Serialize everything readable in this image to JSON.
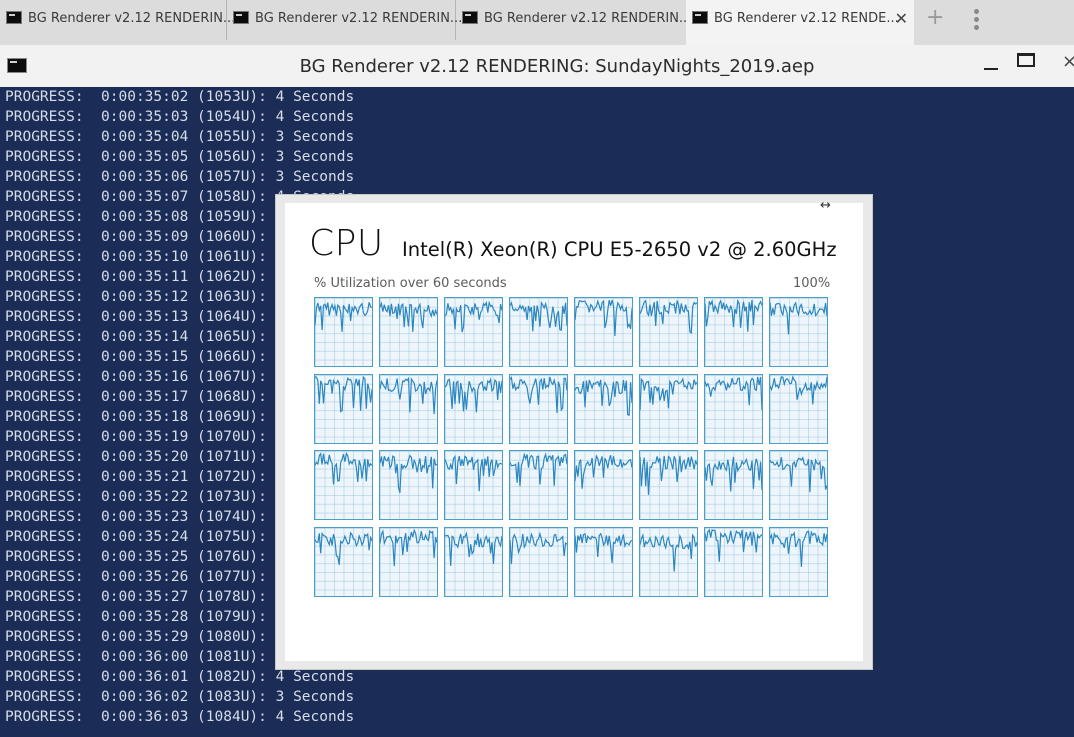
{
  "tabs": [
    {
      "title": "BG Renderer v2.12 RENDERIN...",
      "active": false
    },
    {
      "title": "BG Renderer v2.12 RENDERIN...",
      "active": false
    },
    {
      "title": "BG Renderer v2.12 RENDERIN...",
      "active": false
    },
    {
      "title": "BG Renderer v2.12 RENDE...",
      "active": true,
      "close": "✕"
    }
  ],
  "tabbar": {
    "new_tab": "+"
  },
  "window": {
    "title": "BG Renderer v2.12 RENDERING: SundayNights_2019.aep",
    "close": "×"
  },
  "console": {
    "lines": [
      "PROGRESS:  0:00:35:02 (1053U): 4 Seconds",
      "PROGRESS:  0:00:35:03 (1054U): 4 Seconds",
      "PROGRESS:  0:00:35:04 (1055U): 3 Seconds",
      "PROGRESS:  0:00:35:05 (1056U): 3 Seconds",
      "PROGRESS:  0:00:35:06 (1057U): 3 Seconds",
      "PROGRESS:  0:00:35:07 (1058U): 4 Seconds",
      "PROGRESS:  0:00:35:08 (1059U):",
      "PROGRESS:  0:00:35:09 (1060U):",
      "PROGRESS:  0:00:35:10 (1061U):",
      "PROGRESS:  0:00:35:11 (1062U):",
      "PROGRESS:  0:00:35:12 (1063U):",
      "PROGRESS:  0:00:35:13 (1064U):",
      "PROGRESS:  0:00:35:14 (1065U):",
      "PROGRESS:  0:00:35:15 (1066U):",
      "PROGRESS:  0:00:35:16 (1067U):",
      "PROGRESS:  0:00:35:17 (1068U):",
      "PROGRESS:  0:00:35:18 (1069U):",
      "PROGRESS:  0:00:35:19 (1070U):",
      "PROGRESS:  0:00:35:20 (1071U):",
      "PROGRESS:  0:00:35:21 (1072U):",
      "PROGRESS:  0:00:35:22 (1073U):",
      "PROGRESS:  0:00:35:23 (1074U):",
      "PROGRESS:  0:00:35:24 (1075U):",
      "PROGRESS:  0:00:35:25 (1076U):",
      "PROGRESS:  0:00:35:26 (1077U):",
      "PROGRESS:  0:00:35:27 (1078U):",
      "PROGRESS:  0:00:35:28 (1079U):",
      "PROGRESS:  0:00:35:29 (1080U):",
      "PROGRESS:  0:00:36:00 (1081U):",
      "PROGRESS:  0:00:36:01 (1082U): 4 Seconds",
      "PROGRESS:  0:00:36:02 (1083U): 3 Seconds",
      "PROGRESS:  0:00:36:03 (1084U): 4 Seconds"
    ]
  },
  "cpu_panel": {
    "label": "CPU",
    "model": "Intel(R) Xeon(R) CPU E5-2650 v2 @ 2.60GHz",
    "utilization_label": "% Utilization over 60 seconds",
    "max_label": "100%",
    "resize_glyph": "↔",
    "graph_color": "#2b86c0",
    "cores": 32,
    "rows": 4,
    "cols": 8
  }
}
